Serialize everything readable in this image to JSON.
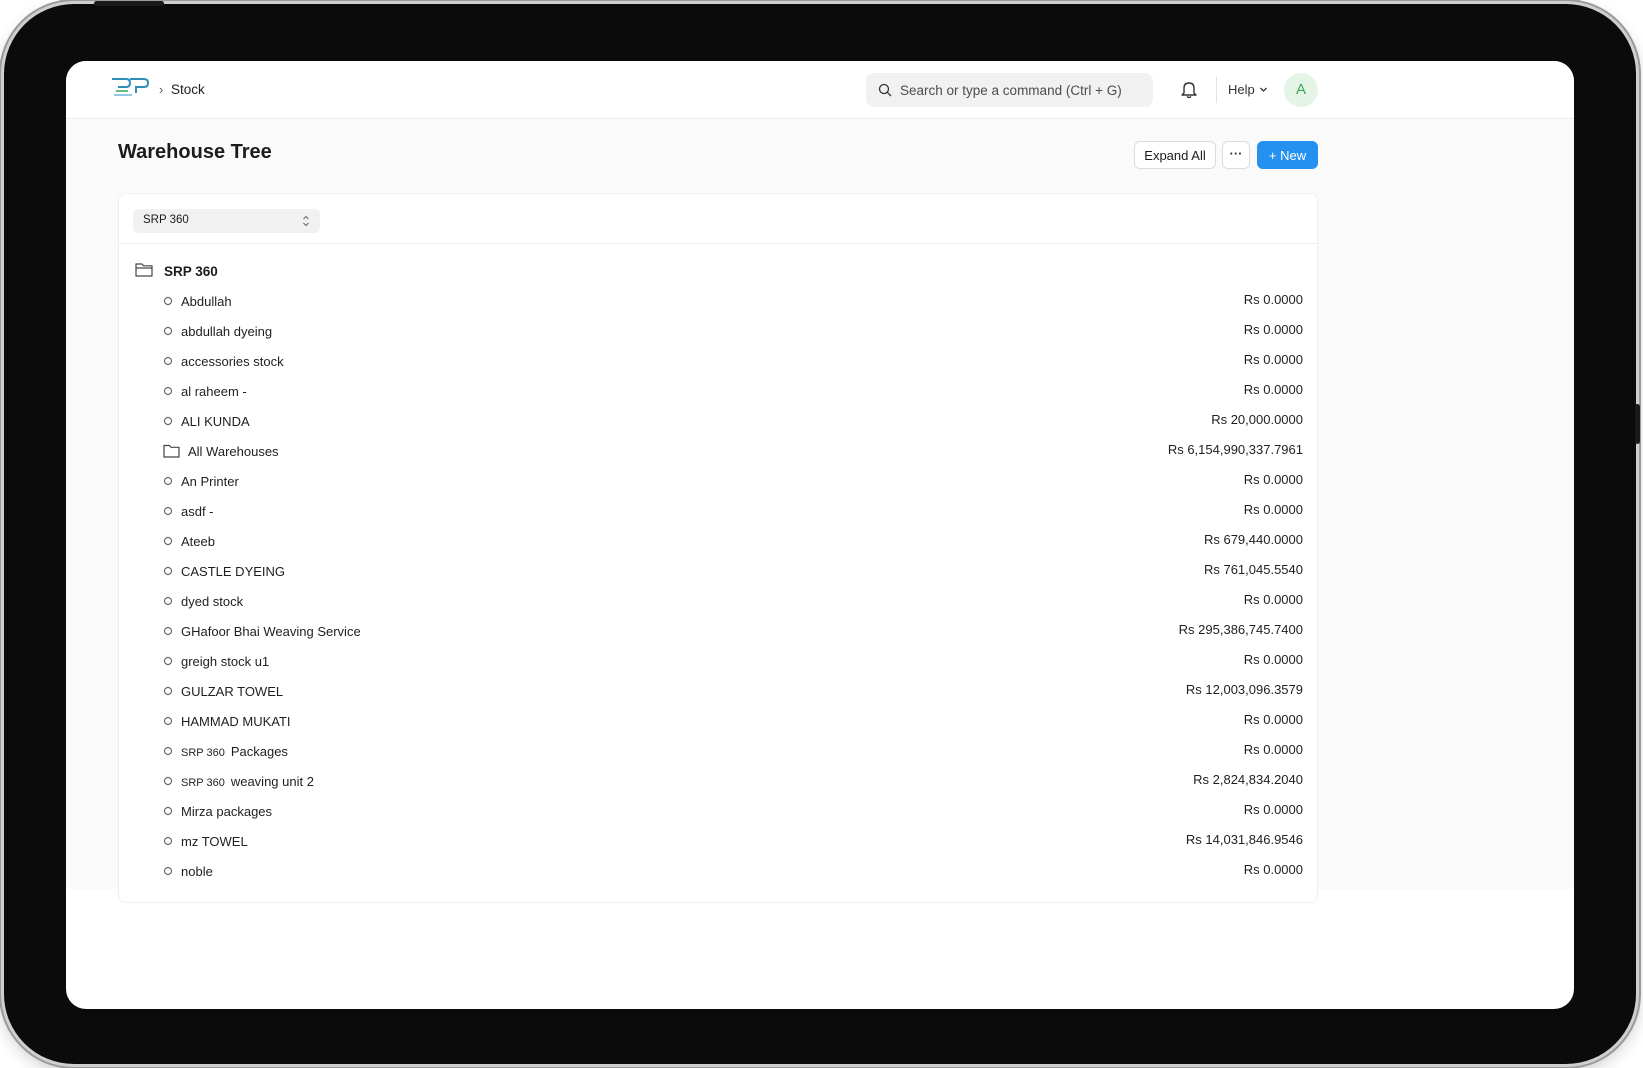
{
  "navbar": {
    "breadcrumb": "Stock",
    "breadcrumb_sep": "›",
    "search_placeholder": "Search or type a command (Ctrl + G)",
    "help_label": "Help",
    "avatar_initial": "A"
  },
  "page": {
    "title": "Warehouse Tree",
    "expand_all_label": "Expand All",
    "more_label": "···",
    "new_label": "+ New"
  },
  "filter": {
    "company_value": "SRP 360"
  },
  "tree": {
    "root_label": "SRP 360",
    "rows": [
      {
        "label": "Abdullah",
        "amount": "Rs 0.0000",
        "type": "leaf"
      },
      {
        "label": "abdullah dyeing",
        "amount": "Rs 0.0000",
        "type": "leaf"
      },
      {
        "label": "accessories stock",
        "amount": "Rs 0.0000",
        "type": "leaf"
      },
      {
        "label": "al raheem -",
        "amount": "Rs 0.0000",
        "type": "leaf"
      },
      {
        "label": "ALI KUNDA",
        "amount": "Rs 20,000.0000",
        "type": "leaf"
      },
      {
        "label": "All Warehouses",
        "amount": "Rs 6,154,990,337.7961",
        "type": "group"
      },
      {
        "label": "An Printer",
        "amount": "Rs 0.0000",
        "type": "leaf"
      },
      {
        "label": "asdf -",
        "amount": "Rs 0.0000",
        "type": "leaf"
      },
      {
        "label": "Ateeb",
        "amount": "Rs 679,440.0000",
        "type": "leaf"
      },
      {
        "label": "CASTLE DYEING",
        "amount": "Rs 761,045.5540",
        "type": "leaf"
      },
      {
        "label": "dyed stock",
        "amount": "Rs 0.0000",
        "type": "leaf"
      },
      {
        "label": "GHafoor Bhai Weaving Service",
        "amount": "Rs 295,386,745.7400",
        "type": "leaf"
      },
      {
        "label": "greigh stock u1",
        "amount": "Rs 0.0000",
        "type": "leaf"
      },
      {
        "label": "GULZAR TOWEL",
        "amount": "Rs 12,003,096.3579",
        "type": "leaf"
      },
      {
        "label": "HAMMAD MUKATI",
        "amount": "Rs 0.0000",
        "type": "leaf"
      },
      {
        "prefix": "SRP 360",
        "label": "Packages",
        "amount": "Rs 0.0000",
        "type": "leaf"
      },
      {
        "prefix": "SRP 360",
        "label": "weaving unit 2",
        "amount": "Rs 2,824,834.2040",
        "type": "leaf"
      },
      {
        "label": "Mirza packages",
        "amount": "Rs 0.0000",
        "type": "leaf"
      },
      {
        "label": "mz TOWEL",
        "amount": "Rs 14,031,846.9546",
        "type": "leaf"
      },
      {
        "label": "noble",
        "amount": "Rs 0.0000",
        "type": "leaf"
      }
    ]
  },
  "colors": {
    "primary": "#2490ef",
    "avatar_bg": "#e4f5e7",
    "avatar_fg": "#3aa757"
  },
  "icons": [
    "app-logo-icon",
    "search-icon",
    "bell-icon",
    "chevron-down-icon",
    "folder-icon",
    "circle-node-icon",
    "select-arrows-icon"
  ]
}
